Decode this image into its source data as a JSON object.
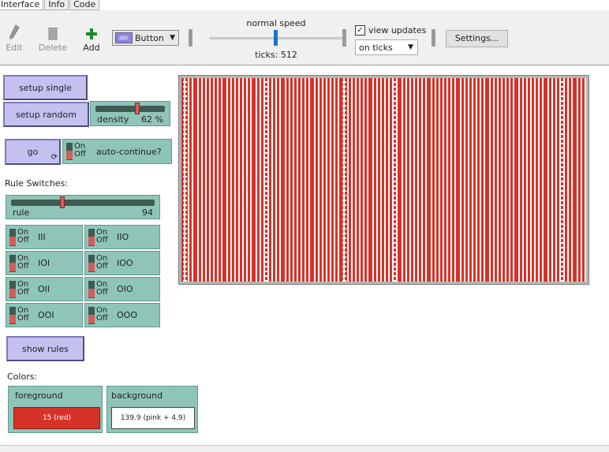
{
  "tabs": [
    {
      "label": "Interface",
      "active": true
    },
    {
      "label": "Info",
      "active": false
    },
    {
      "label": "Code",
      "active": false
    }
  ],
  "toolbar": {
    "edit_label": "Edit",
    "delete_label": "Delete",
    "add_label": "Add",
    "widget_type": "Button",
    "speed_label": "normal speed",
    "ticks_text": "ticks: 512",
    "view_updates_label": "view updates",
    "view_updates_checked": true,
    "update_mode": "on ticks",
    "settings_label": "Settings..."
  },
  "widgets": {
    "setup_single": "setup single",
    "setup_random": "setup random",
    "density": {
      "name": "density",
      "value": "62 %",
      "fraction": 0.62
    },
    "go": "go",
    "auto_continue": "auto-continue?",
    "rule_switches_label": "Rule Switches:",
    "rule": {
      "name": "rule",
      "value": "94",
      "fraction": 0.37
    },
    "switches": [
      "III",
      "IIO",
      "IOI",
      "IOO",
      "OII",
      "OIO",
      "OOI",
      "OOO"
    ],
    "on_label": "On",
    "off_label": "Off",
    "show_rules": "show rules",
    "colors_label": "Colors:",
    "foreground": {
      "name": "foreground",
      "value": "15 (red)",
      "color": "#d73229"
    },
    "background": {
      "name": "background",
      "value": "139.9 (pink + 4.9)",
      "color": "#ffffff"
    }
  },
  "world": {
    "stripe_color": "#d73229",
    "bg_color": "#ffffff",
    "frame_color": "#b5b5b5"
  },
  "icons": {
    "edit": "pencil-icon",
    "delete": "trash-icon",
    "add": "plus-icon",
    "forever": "forever-icon"
  }
}
